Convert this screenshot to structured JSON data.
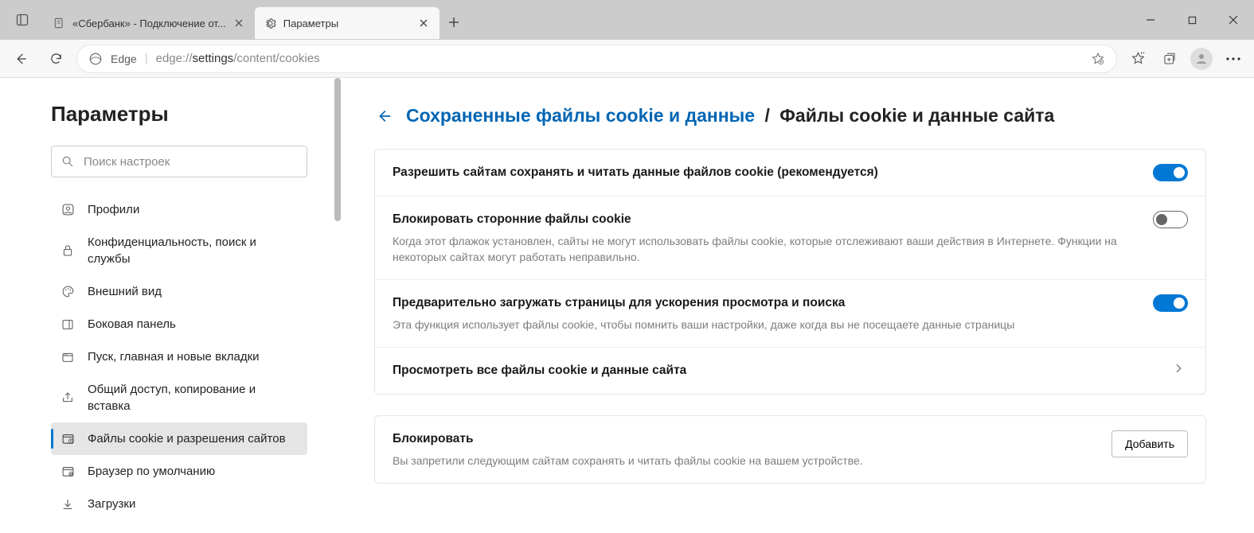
{
  "titlebar": {
    "tabs": [
      {
        "label": "«Сбербанк» - Подключение от..."
      },
      {
        "label": "Параметры"
      }
    ],
    "active_index": 1
  },
  "toolbar": {
    "edge_label": "Edge",
    "url_prefix": "edge://",
    "url_bold": "settings",
    "url_suffix": "/content/cookies"
  },
  "sidebar": {
    "title": "Параметры",
    "search_placeholder": "Поиск настроек",
    "items": [
      {
        "label": "Профили"
      },
      {
        "label": "Конфиденциальность, поиск и службы"
      },
      {
        "label": "Внешний вид"
      },
      {
        "label": "Боковая панель"
      },
      {
        "label": "Пуск, главная и новые вкладки"
      },
      {
        "label": "Общий доступ, копирование и вставка"
      },
      {
        "label": "Файлы cookie и разрешения сайтов"
      },
      {
        "label": "Браузер по умолчанию"
      },
      {
        "label": "Загрузки"
      }
    ],
    "active_index": 6
  },
  "main": {
    "breadcrumb": {
      "link": "Сохраненные файлы cookie и данные",
      "current": "Файлы cookie и данные сайта"
    },
    "rows": {
      "allow": {
        "title": "Разрешить сайтам сохранять и читать данные файлов cookie (рекомендуется)",
        "on": true
      },
      "block3p": {
        "title": "Блокировать сторонние файлы cookie",
        "desc": "Когда этот флажок установлен, сайты не могут использовать файлы cookie, которые отслеживают ваши действия в Интернете. Функции на некоторых сайтах могут работать неправильно.",
        "on": false
      },
      "preload": {
        "title": "Предварительно загружать страницы для ускорения просмотра и поиска",
        "desc": "Эта функция использует файлы cookie, чтобы помнить ваши настройки, даже когда вы не посещаете данные страницы",
        "on": true
      },
      "seeall": {
        "title": "Просмотреть все файлы cookie и данные сайта"
      }
    },
    "block_section": {
      "title": "Блокировать",
      "desc": "Вы запретили следующим сайтам сохранять и читать файлы cookie на вашем устройстве.",
      "add_label": "Добавить"
    }
  }
}
